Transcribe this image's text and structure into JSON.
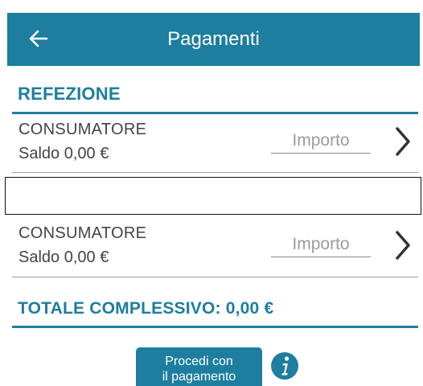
{
  "header": {
    "title": "Pagamenti",
    "back_icon": "arrow-left-icon"
  },
  "section": {
    "title": "REFEZIONE"
  },
  "rows": [
    {
      "consumer": "CONSUMATORE",
      "saldo": "Saldo 0,00 €",
      "amount_placeholder": "Importo",
      "amount_value": ""
    },
    {
      "consumer": "CONSUMATORE",
      "saldo": "Saldo 0,00 €",
      "amount_placeholder": "Importo",
      "amount_value": ""
    }
  ],
  "total": {
    "label": "TOTALE COMPLESSIVO: 0,00 €"
  },
  "actions": {
    "pay_line1": "Procedi con",
    "pay_line2": "il pagamento",
    "info_icon": "info-icon"
  },
  "colors": {
    "accent": "#1d7e9f",
    "text": "#444444"
  }
}
